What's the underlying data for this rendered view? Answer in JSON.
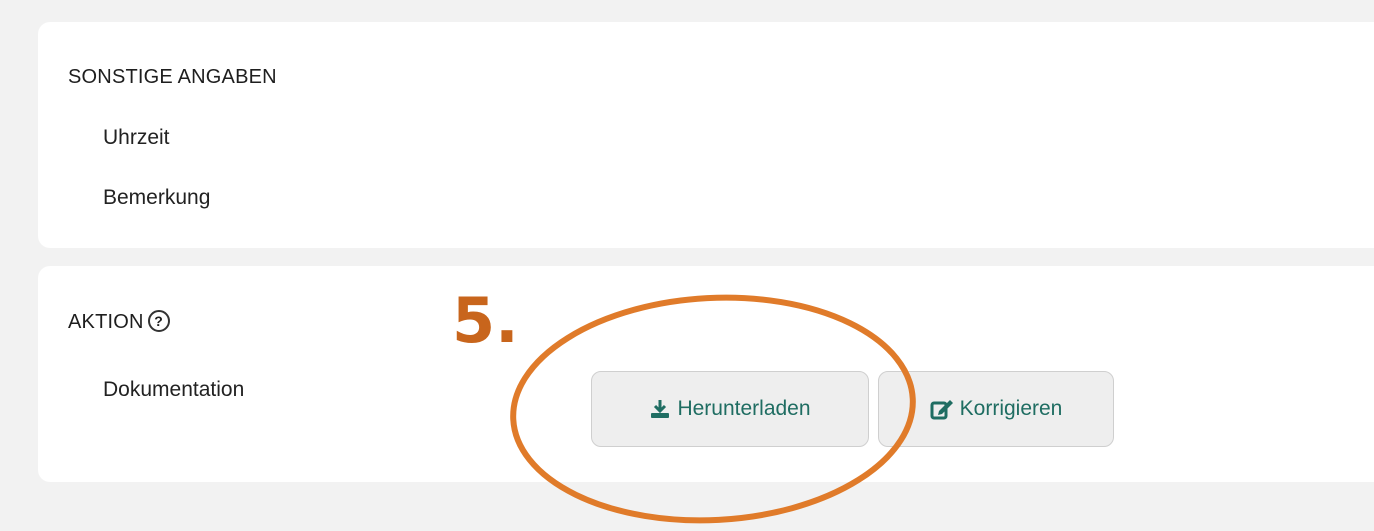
{
  "sonstige": {
    "title": "SONSTIGE ANGABEN",
    "fields": [
      "Uhrzeit",
      "Bemerkung"
    ]
  },
  "aktion": {
    "title": "AKTION",
    "help_icon": "help-circle-icon",
    "row_label": "Dokumentation",
    "download_label": "Herunterladen",
    "download_icon": "download-icon",
    "edit_label": "Korrigieren",
    "edit_icon": "edit-icon"
  },
  "annotation": {
    "step": "5.",
    "color": "#e07b2a"
  },
  "colors": {
    "accent": "#1f6d62",
    "annotation": "#e07b2a",
    "background": "#f2f2f2"
  }
}
